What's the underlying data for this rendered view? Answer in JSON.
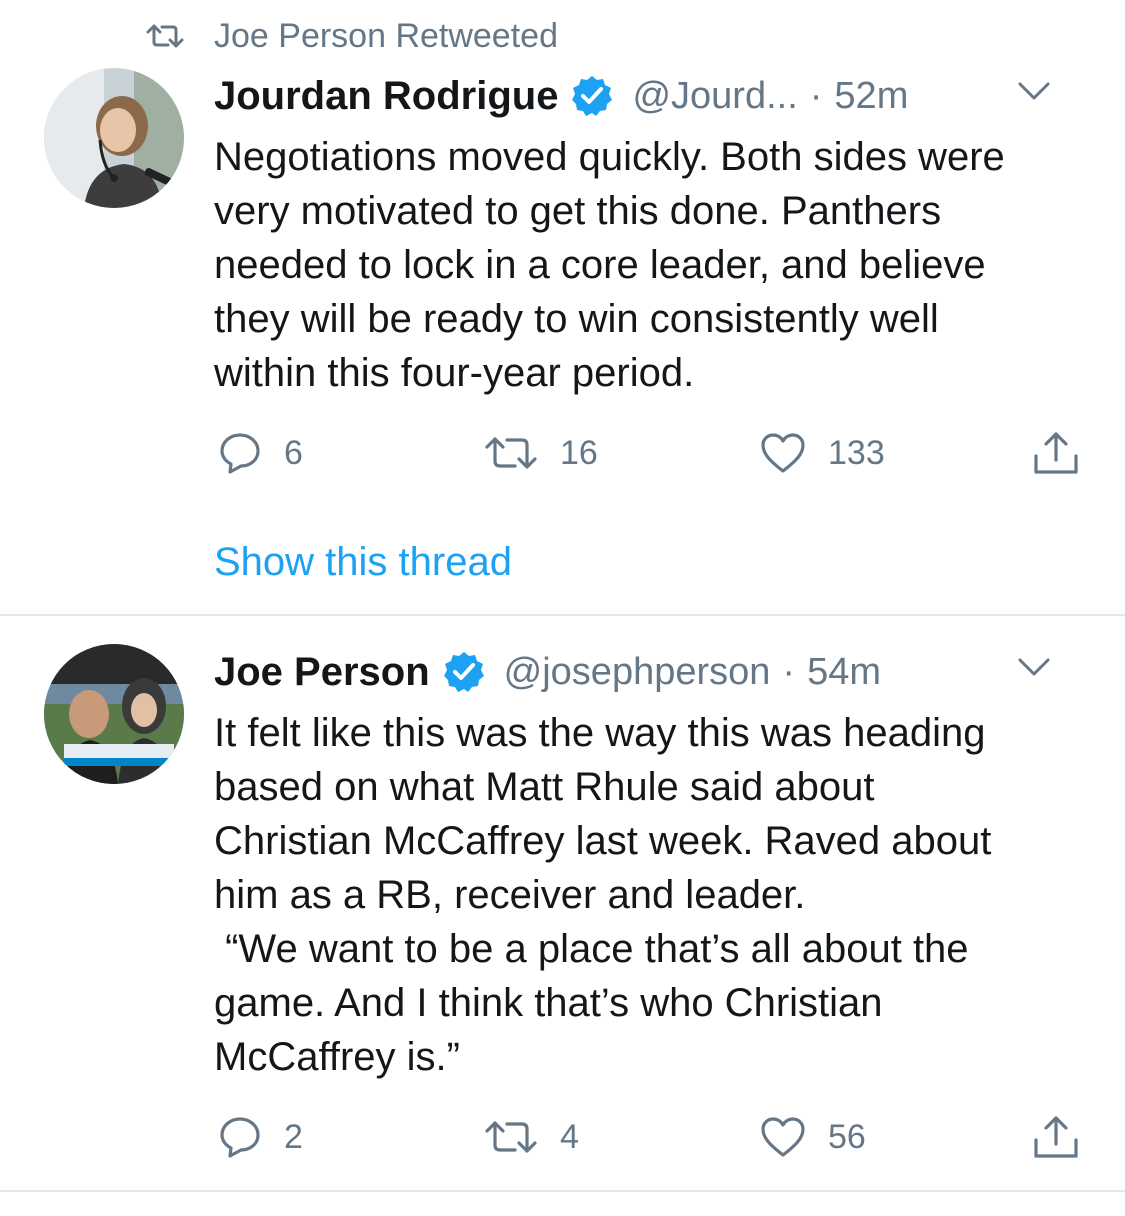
{
  "colors": {
    "accent": "#1da1f2",
    "muted": "#657786",
    "text": "#14171a",
    "divider": "#e1e8ed"
  },
  "tweets": [
    {
      "retweeted_by": "Joe Person Retweeted",
      "author": {
        "name": "Jourdan Rodrigue",
        "handle": "@Jourd...",
        "verified": true,
        "avatar_icon": "avatar-photo"
      },
      "separator": "·",
      "time": "52m",
      "text_lines": [
        "Negotiations moved quickly. Both sides were",
        "very motivated to get this done. Panthers",
        "needed to lock in a core leader, and believe",
        "they will be ready to win consistently well",
        "within this four-year period."
      ],
      "stats": {
        "replies": "6",
        "retweets": "16",
        "likes": "133"
      },
      "show_thread": "Show this thread"
    },
    {
      "author": {
        "name": "Joe Person",
        "handle": "@josephperson",
        "verified": true,
        "avatar_icon": "avatar-photo"
      },
      "separator": "·",
      "time": "54m",
      "text_lines": [
        "It felt like this was the way this was heading",
        "based on what Matt Rhule said about",
        "Christian McCaffrey last week. Raved about",
        "him as a RB, receiver and leader.",
        " “We want to be a place that’s all about the",
        "game. And I think that’s who Christian",
        "McCaffrey is.”"
      ],
      "stats": {
        "replies": "2",
        "retweets": "4",
        "likes": "56"
      }
    }
  ],
  "icons": {
    "retweet": "retweet-icon",
    "verified": "verified-badge-icon",
    "caret": "chevron-down-icon",
    "reply": "reply-icon",
    "like": "heart-icon",
    "share": "share-icon"
  }
}
